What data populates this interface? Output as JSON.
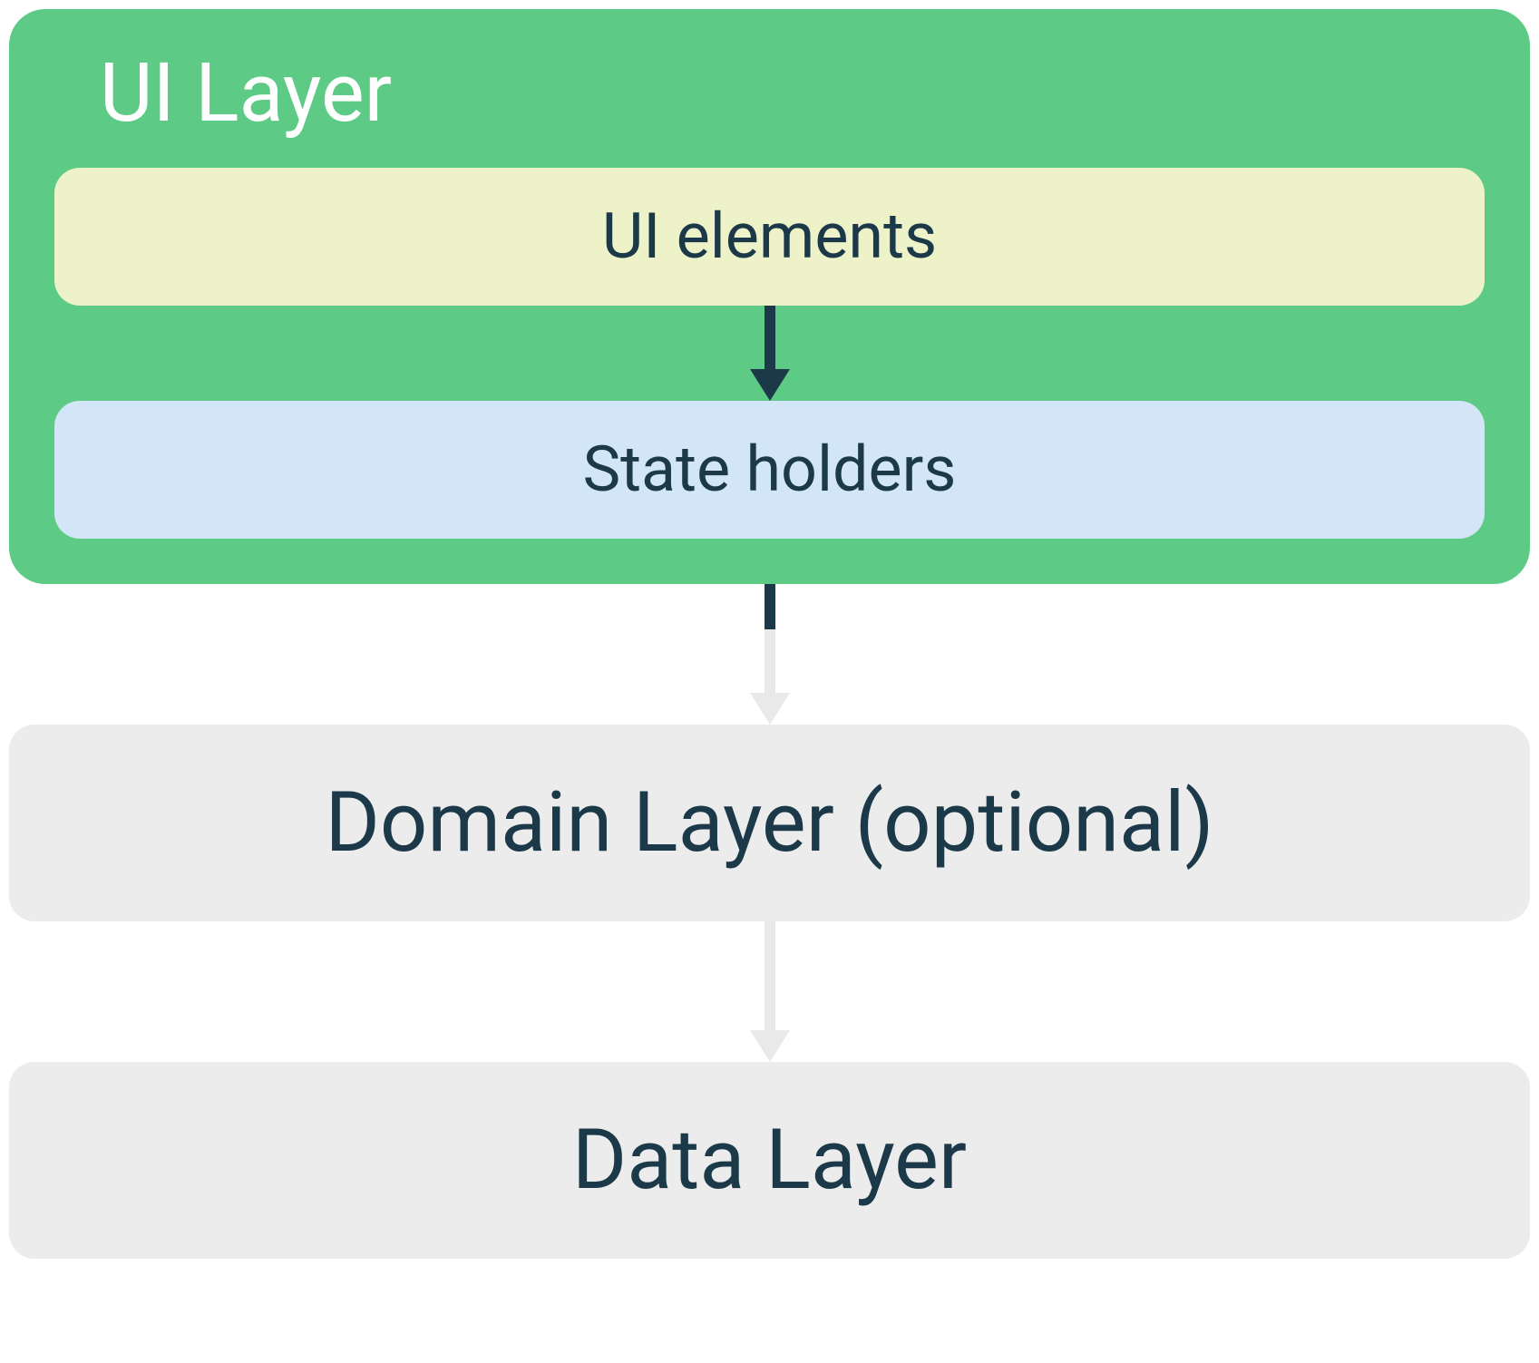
{
  "colors": {
    "green": "#5dcb85",
    "yellow": "#eef2c8",
    "lightblue": "#d3e6f7",
    "grey": "#ececec",
    "darktext": "#1b3948",
    "white": "#ffffff",
    "arrow_dark": "#1b3948",
    "arrow_light": "#e9e9e9"
  },
  "ui_layer": {
    "title": "UI Layer",
    "ui_elements": "UI elements",
    "state_holders": "State holders"
  },
  "domain_layer": {
    "label": "Domain Layer (optional)"
  },
  "data_layer": {
    "label": "Data Layer"
  }
}
